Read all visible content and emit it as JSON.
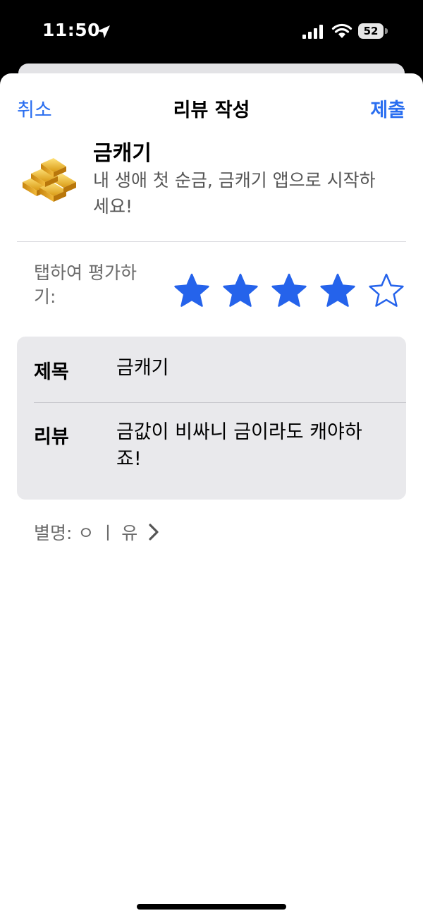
{
  "status": {
    "time": "11:50",
    "battery": "52"
  },
  "nav": {
    "cancel": "취소",
    "title": "리뷰 작성",
    "submit": "제출"
  },
  "app": {
    "name": "금캐기",
    "subtitle": "내 생애 첫 순금, 금캐기 앱으로 시작하세요!",
    "icon": "gold-bars-icon"
  },
  "rating": {
    "label": "탭하여 평가하기:",
    "value": 4,
    "max": 5,
    "color": "#2563EB"
  },
  "form": {
    "title_label": "제목",
    "title_value": "금캐기",
    "review_label": "리뷰",
    "review_value": "금값이 비싸니 금이라도 캐야하죠!"
  },
  "nickname": {
    "text": "별명: ㅇ ㅣ 유"
  },
  "colors": {
    "accent": "#2a6ef0",
    "star": "#2563EB"
  }
}
